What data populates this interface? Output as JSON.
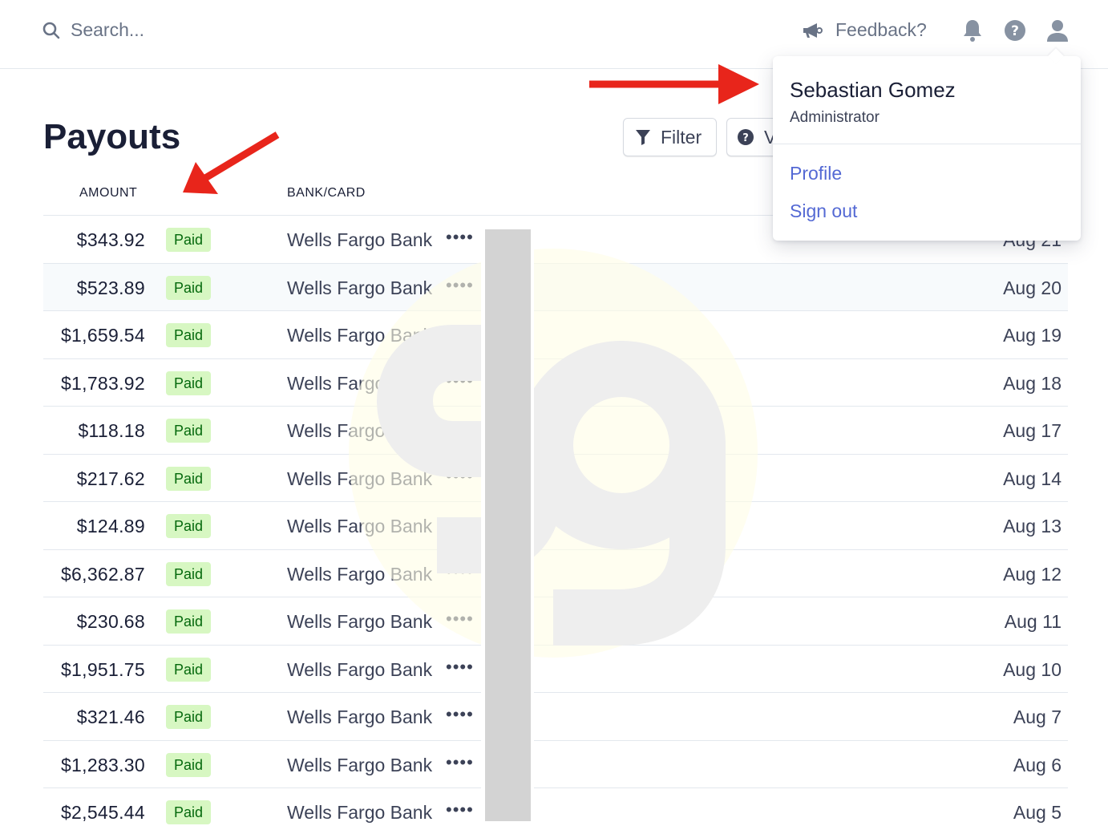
{
  "search": {
    "placeholder": "Search..."
  },
  "header": {
    "feedback_label": "Feedback?"
  },
  "icons": {
    "search": "search-icon",
    "feedback": "megaphone-icon",
    "notifications": "bell-icon",
    "help": "help-icon",
    "account": "user-icon",
    "filter": "filter-icon"
  },
  "user_menu": {
    "name": "Sebastian Gomez",
    "role": "Administrator",
    "links": [
      "Profile",
      "Sign out"
    ]
  },
  "page": {
    "title": "Payouts"
  },
  "toolbar": {
    "filter_label": "Filter",
    "second_button_label": "V"
  },
  "table": {
    "columns": {
      "amount": "AMOUNT",
      "bank": "BANK/CARD"
    },
    "rows": [
      {
        "amount": "$343.92",
        "status": "Paid",
        "bank": "Wells Fargo Bank",
        "mask": "••••",
        "date": "Aug 21"
      },
      {
        "amount": "$523.89",
        "status": "Paid",
        "bank": "Wells Fargo Bank",
        "mask": "••••",
        "date": "Aug 20"
      },
      {
        "amount": "$1,659.54",
        "status": "Paid",
        "bank": "Wells Fargo Bank",
        "mask": "••••",
        "date": "Aug 19"
      },
      {
        "amount": "$1,783.92",
        "status": "Paid",
        "bank": "Wells Fargo Bank",
        "mask": "••••",
        "date": "Aug 18"
      },
      {
        "amount": "$118.18",
        "status": "Paid",
        "bank": "Wells Fargo Bank",
        "mask": "••••",
        "date": "Aug 17"
      },
      {
        "amount": "$217.62",
        "status": "Paid",
        "bank": "Wells Fargo Bank",
        "mask": "••••",
        "date": "Aug 14"
      },
      {
        "amount": "$124.89",
        "status": "Paid",
        "bank": "Wells Fargo Bank",
        "mask": "••••",
        "date": "Aug 13"
      },
      {
        "amount": "$6,362.87",
        "status": "Paid",
        "bank": "Wells Fargo Bank",
        "mask": "••••",
        "date": "Aug 12"
      },
      {
        "amount": "$230.68",
        "status": "Paid",
        "bank": "Wells Fargo Bank",
        "mask": "••••",
        "date": "Aug 11"
      },
      {
        "amount": "$1,951.75",
        "status": "Paid",
        "bank": "Wells Fargo Bank",
        "mask": "••••",
        "date": "Aug 10"
      },
      {
        "amount": "$321.46",
        "status": "Paid",
        "bank": "Wells Fargo Bank",
        "mask": "••••",
        "date": "Aug 7"
      },
      {
        "amount": "$1,283.30",
        "status": "Paid",
        "bank": "Wells Fargo Bank",
        "mask": "••••",
        "date": "Aug 6"
      },
      {
        "amount": "$2,545.44",
        "status": "Paid",
        "bank": "Wells Fargo Bank",
        "mask": "••••",
        "date": "Aug 5"
      }
    ]
  },
  "colors": {
    "accent": "#5469d4",
    "badge_bg": "#d7f7c2",
    "badge_text": "#05690d",
    "annotation_arrow": "#e8251b"
  }
}
